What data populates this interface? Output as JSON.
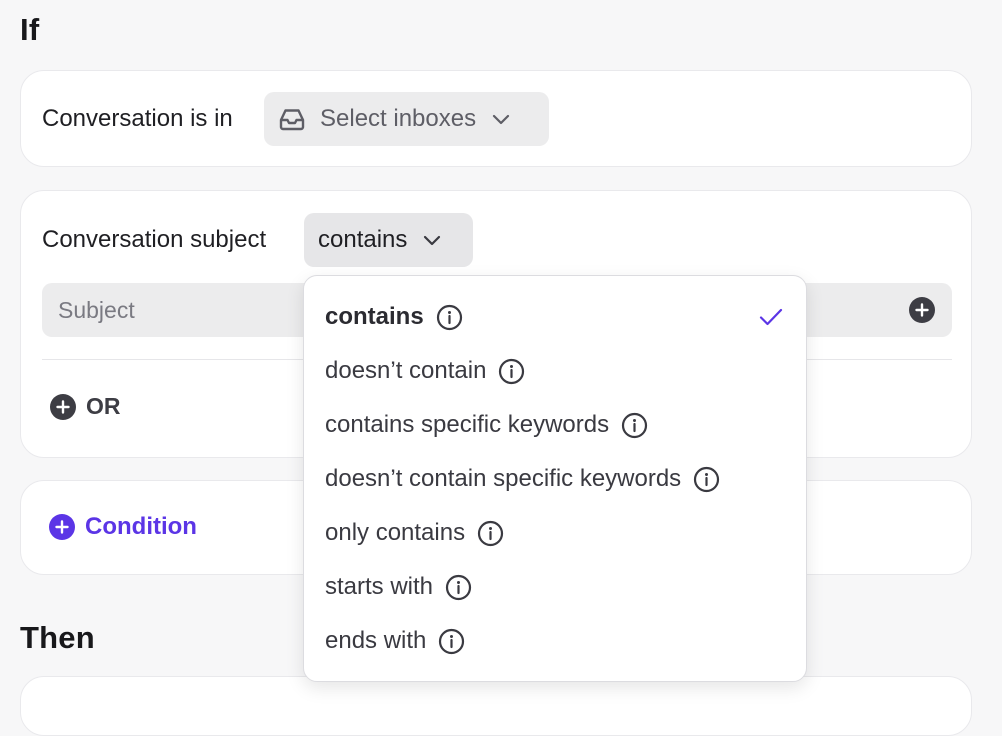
{
  "sections": {
    "if_heading": "If",
    "then_heading": "Then"
  },
  "inbox_rule": {
    "label": "Conversation is in",
    "select_label": "Select inboxes"
  },
  "subject_rule": {
    "label": "Conversation subject",
    "operator_value": "contains",
    "input_placeholder": "Subject",
    "or_label": "OR"
  },
  "condition": {
    "add_label": "Condition"
  },
  "operator_menu": {
    "selected_index": 0,
    "items": [
      {
        "label": "contains"
      },
      {
        "label": "doesn’t contain"
      },
      {
        "label": "contains specific keywords"
      },
      {
        "label": "doesn’t contain specific keywords"
      },
      {
        "label": "only contains"
      },
      {
        "label": "starts with"
      },
      {
        "label": "ends with"
      }
    ]
  },
  "icons": {
    "inbox": "inbox-tray-icon",
    "chevron": "chevron-down-icon",
    "plus": "plus-circle-icon",
    "info": "info-circle-icon",
    "check": "checkmark-icon"
  },
  "colors": {
    "accent": "#5b35e6",
    "dark_circle": "#3d3d44",
    "pill_background": "#ececed",
    "card_background": "#ffffff",
    "page_background": "#f7f7f8"
  }
}
